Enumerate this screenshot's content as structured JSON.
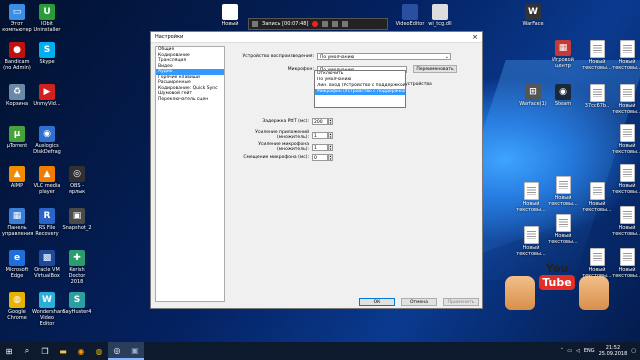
{
  "desktop_icons": [
    {
      "name": "this-pc",
      "label": "Этот\nкомпьютер",
      "glyph": "▭",
      "color": "#3a8ee6"
    },
    {
      "name": "iobit",
      "label": "IObit\nUninstaller",
      "glyph": "U",
      "color": "#2a9d3a"
    },
    {
      "name": "bandicam",
      "label": "Bandicam\n(no Admin)",
      "glyph": "●",
      "color": "#c01010"
    },
    {
      "name": "skype",
      "label": "Skype",
      "glyph": "S",
      "color": "#00aff0"
    },
    {
      "name": "recycle",
      "label": "Корзина",
      "glyph": "♻",
      "color": "#6a8aa8"
    },
    {
      "name": "unmyvideo",
      "label": "UnmyVid...",
      "glyph": "▶",
      "color": "#d02020"
    },
    {
      "name": "utorrent",
      "label": "µTorrent",
      "glyph": "µ",
      "color": "#46a23a"
    },
    {
      "name": "auslogics",
      "label": "Auslogics\nDiskDefrag",
      "glyph": "◉",
      "color": "#2f6fd0"
    },
    {
      "name": "aimp",
      "label": "AIMP",
      "glyph": "▲",
      "color": "#f08c00"
    },
    {
      "name": "vlc",
      "label": "VLC media\nplayer",
      "glyph": "▲",
      "color": "#f07d00"
    },
    {
      "name": "obs",
      "label": "OBS -\nярлык",
      "glyph": "◎",
      "color": "#303030"
    },
    {
      "name": "control-panel",
      "label": "Панель\nуправления",
      "glyph": "▦",
      "color": "#3a7fd5"
    },
    {
      "name": "rsfile",
      "label": "RS File\nRecovery",
      "glyph": "R",
      "color": "#2a64c8"
    },
    {
      "name": "snapshot",
      "label": "Snapshot_2",
      "glyph": "▣",
      "color": "#4a4a4a"
    },
    {
      "name": "edge",
      "label": "Microsoft\nEdge",
      "glyph": "e",
      "color": "#1e6fd9"
    },
    {
      "name": "virtualbox",
      "label": "Oracle VM\nVirtualBox",
      "glyph": "▩",
      "color": "#1c4a9c"
    },
    {
      "name": "kerish",
      "label": "Kerish Doctor\n2018",
      "glyph": "✚",
      "color": "#2a9d6a"
    },
    {
      "name": "chrome",
      "label": "Google\nChrome",
      "glyph": "◍",
      "color": "#e8b300"
    },
    {
      "name": "wondershare",
      "label": "Wondershare\nVideo Editor",
      "glyph": "W",
      "color": "#2ab0d8"
    },
    {
      "name": "sayhuster",
      "label": "SayHuster4",
      "glyph": "S",
      "color": "#2aa0a0"
    }
  ],
  "top_icons": [
    {
      "label": "Новый"
    },
    {
      "label": "VideoEditor"
    },
    {
      "label": "wi_tcg.dll"
    }
  ],
  "right_icons": [
    {
      "label": "WarFace",
      "glyph": "W",
      "color": "#333"
    },
    {
      "label": "Игровой\nцентр",
      "glyph": "▦",
      "color": "#c23a3a"
    },
    {
      "label": "Новый\nтекстовы...",
      "glyph": "",
      "color": ""
    },
    {
      "label": "Новый\nтекстовы...",
      "glyph": "",
      "color": ""
    },
    {
      "label": "Warface(1)",
      "glyph": "⊞",
      "color": "#555"
    },
    {
      "label": "Steam",
      "glyph": "◉",
      "color": "#1b2838"
    },
    {
      "label": "37cc67b..",
      "glyph": "",
      "color": ""
    },
    {
      "label": "Новый\nтекстовы...",
      "glyph": "",
      "color": ""
    },
    {
      "label": "Новый\nтекстовы...",
      "glyph": "",
      "color": ""
    },
    {
      "label": "Новый\nтекстовы...",
      "glyph": "",
      "color": ""
    },
    {
      "label": "Новый\nтекстовы...",
      "glyph": "",
      "color": ""
    },
    {
      "label": "Новый\nтекстовы...",
      "glyph": "",
      "color": ""
    },
    {
      "label": "Новый\nтекстовы...",
      "glyph": "",
      "color": ""
    },
    {
      "label": "Новый\nтекстовы...",
      "glyph": "",
      "color": ""
    },
    {
      "label": "Новый\nтекстовы...",
      "glyph": "",
      "color": ""
    },
    {
      "label": "Новый\nтекстовы...",
      "glyph": "",
      "color": ""
    },
    {
      "label": "Новый\nтекстовы...",
      "glyph": "",
      "color": ""
    },
    {
      "label": "Новый\nтекстовы...",
      "glyph": "",
      "color": ""
    }
  ],
  "recording_toolbar": {
    "label": "Запись [00:07:48]"
  },
  "settings_window": {
    "title": "Настройки",
    "nav_items": [
      "Общие",
      "Кодирование",
      "Трансляция",
      "Видео",
      "Аудио",
      "Горячие клавиши",
      "Расширенные",
      "Кодирование: Quick Sync",
      "Шумовой гейт",
      "Переключатель сцен"
    ],
    "selected_nav_index": 4,
    "playback_label": "Устройство воспроизведения:",
    "playback_value": "По умолчанию",
    "mic_label": "Микрофон:",
    "mic_value": "По умолчанию",
    "rename_button": "Переименовать",
    "mic_overflow_text": "устройства",
    "dropdown_options": [
      "Отключить",
      "По умолчанию",
      "Лин. вход (Устройство с поддержкой High",
      "Микрофон (Устройство с поддержкой High"
    ],
    "dropdown_selected_index": 3,
    "delay_label": "Задержка PttT (мс):",
    "delay_value": "200",
    "app_gain_label": "Усиление приложений (множитель):",
    "app_gain_value": "1",
    "mic_gain_label": "Усиление микрофона (множитель):",
    "mic_gain_value": "1",
    "mic_offset_label": "Смещение микрофона (мс):",
    "mic_offset_value": "0",
    "ok_button": "ОК",
    "cancel_button": "Отмена",
    "apply_button": "Применить"
  },
  "youtube": {
    "you": "You",
    "tube": "Tube"
  },
  "taskbar": {
    "apps": [
      "start",
      "search",
      "task-view",
      "explorer",
      "browser",
      "chrome",
      "obs",
      "settings"
    ],
    "tray": {
      "lang": "ENG",
      "time": "21:52",
      "date": "25.09.2018"
    }
  }
}
